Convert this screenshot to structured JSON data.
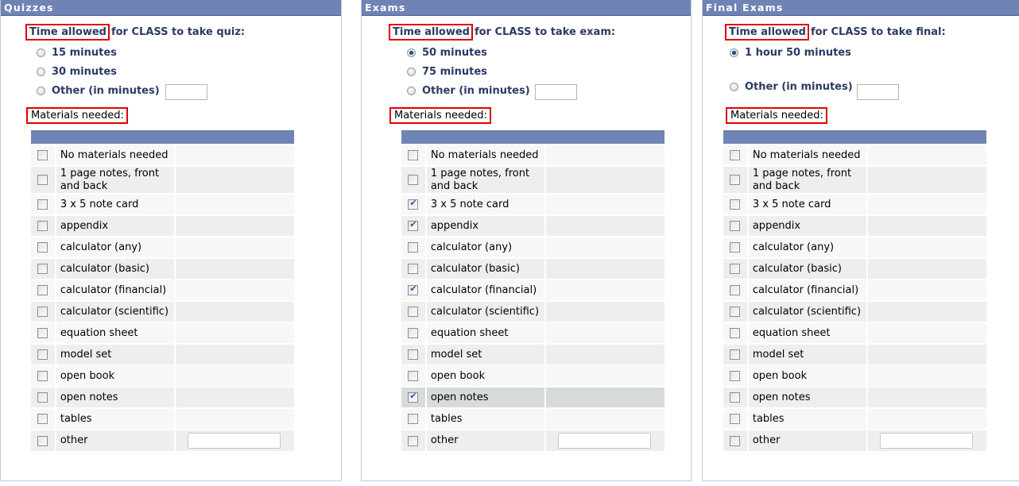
{
  "panels": [
    {
      "title": "Quizzes",
      "time_highlight": "Time allowed",
      "time_rest": "for CLASS to take quiz:",
      "options": [
        {
          "label": "15 minutes",
          "checked": false
        },
        {
          "label": "30 minutes",
          "checked": false
        },
        {
          "label": "Other (in minutes)",
          "checked": false
        }
      ],
      "other_minutes_value": "",
      "materials_label": "Materials needed:",
      "materials": [
        {
          "label": "No materials needed",
          "checked": false
        },
        {
          "label": "1 page notes, front and back",
          "checked": false
        },
        {
          "label": "3 x 5 note card",
          "checked": false
        },
        {
          "label": "appendix",
          "checked": false
        },
        {
          "label": "calculator (any)",
          "checked": false
        },
        {
          "label": "calculator (basic)",
          "checked": false
        },
        {
          "label": "calculator (financial)",
          "checked": false
        },
        {
          "label": "calculator (scientific)",
          "checked": false
        },
        {
          "label": "equation sheet",
          "checked": false
        },
        {
          "label": "model set",
          "checked": false
        },
        {
          "label": "open book",
          "checked": false
        },
        {
          "label": "open notes",
          "checked": false
        },
        {
          "label": "tables",
          "checked": false
        },
        {
          "label": "other",
          "checked": false
        }
      ],
      "other_material_value": ""
    },
    {
      "title": "Exams",
      "time_highlight": "Time allowed",
      "time_rest": "for CLASS to take exam:",
      "options": [
        {
          "label": "50 minutes",
          "checked": true
        },
        {
          "label": "75 minutes",
          "checked": false
        },
        {
          "label": "Other (in minutes)",
          "checked": false
        }
      ],
      "other_minutes_value": "",
      "materials_label": "Materials needed:",
      "materials": [
        {
          "label": "No materials needed",
          "checked": false
        },
        {
          "label": "1 page notes, front and back",
          "checked": false
        },
        {
          "label": "3 x 5 note card",
          "checked": true
        },
        {
          "label": "appendix",
          "checked": true
        },
        {
          "label": "calculator (any)",
          "checked": false
        },
        {
          "label": "calculator (basic)",
          "checked": false
        },
        {
          "label": "calculator (financial)",
          "checked": true
        },
        {
          "label": "calculator (scientific)",
          "checked": false
        },
        {
          "label": "equation sheet",
          "checked": false
        },
        {
          "label": "model set",
          "checked": false
        },
        {
          "label": "open book",
          "checked": false
        },
        {
          "label": "open notes",
          "checked": true,
          "highlighted": true
        },
        {
          "label": "tables",
          "checked": false
        },
        {
          "label": "other",
          "checked": false
        }
      ],
      "other_material_value": ""
    },
    {
      "title": "Final Exams",
      "time_highlight": "Time allowed",
      "time_rest": "for CLASS to take final:",
      "options": [
        {
          "label": "1 hour 50 minutes",
          "checked": true
        },
        {
          "label": "Other (in minutes)",
          "checked": false
        }
      ],
      "other_minutes_value": "",
      "materials_label": "Materials needed:",
      "materials": [
        {
          "label": "No materials needed",
          "checked": false
        },
        {
          "label": "1 page notes, front and back",
          "checked": false
        },
        {
          "label": "3 x 5 note card",
          "checked": false
        },
        {
          "label": "appendix",
          "checked": false
        },
        {
          "label": "calculator (any)",
          "checked": false
        },
        {
          "label": "calculator (basic)",
          "checked": false
        },
        {
          "label": "calculator (financial)",
          "checked": false
        },
        {
          "label": "calculator (scientific)",
          "checked": false
        },
        {
          "label": "equation sheet",
          "checked": false
        },
        {
          "label": "model set",
          "checked": false
        },
        {
          "label": "open book",
          "checked": false
        },
        {
          "label": "open notes",
          "checked": false
        },
        {
          "label": "tables",
          "checked": false
        },
        {
          "label": "other",
          "checked": false
        }
      ],
      "other_material_value": ""
    }
  ]
}
